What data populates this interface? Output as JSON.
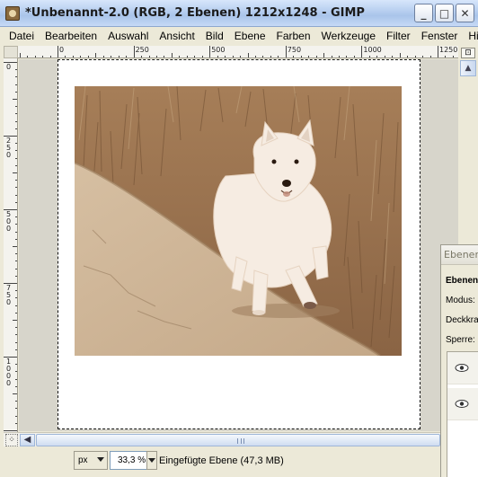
{
  "window": {
    "title": "*Unbenannt-2.0 (RGB, 2 Ebenen) 1212x1248 - GIMP",
    "buttons": {
      "minimize": "_",
      "maximize": "□",
      "close": "✕"
    }
  },
  "menu": [
    {
      "label": "Datei"
    },
    {
      "label": "Bearbeiten"
    },
    {
      "label": "Auswahl"
    },
    {
      "label": "Ansicht"
    },
    {
      "label": "Bild"
    },
    {
      "label": "Ebene"
    },
    {
      "label": "Farben"
    },
    {
      "label": "Werkzeuge"
    },
    {
      "label": "Filter"
    },
    {
      "label": "Fenster"
    },
    {
      "label": "Hilfe"
    }
  ],
  "hruler": {
    "labels": [
      "0",
      "250",
      "500",
      "750",
      "1000",
      "1250"
    ]
  },
  "vruler": {
    "labels": [
      [
        "0"
      ],
      [
        "2",
        "5",
        "0"
      ],
      [
        "5",
        "0",
        "0"
      ],
      [
        "7",
        "5",
        "0"
      ],
      [
        "1",
        "0",
        "0",
        "0"
      ]
    ]
  },
  "layers_panel": {
    "title": "Ebenen",
    "heading": "Ebenen",
    "mode_label": "Modus:",
    "opacity_label": "Deckkraft",
    "lock_label": "Sperre:"
  },
  "statusbar": {
    "unit": "px",
    "zoom": "33,3 %",
    "message": "Eingefügte Ebene (47,3 MB)"
  },
  "colors": {
    "sepia_light": "#d9c3a4",
    "sepia_dark": "#7a5a3a",
    "grass": "#8e6a47"
  }
}
